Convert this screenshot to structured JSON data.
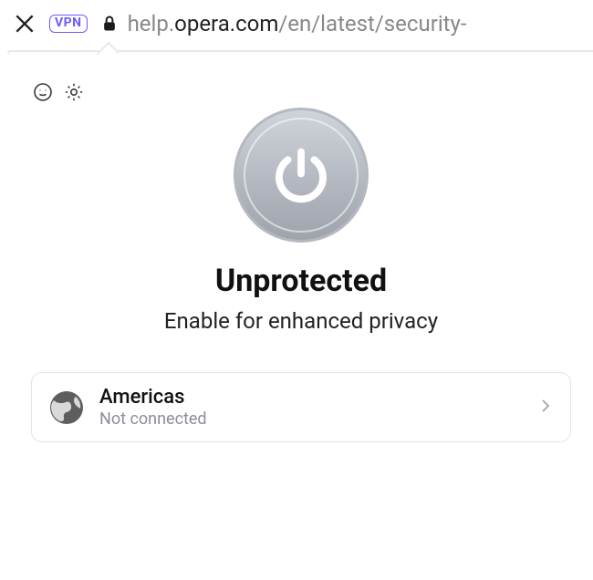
{
  "topbar": {
    "vpn_badge": "VPN",
    "url_prefix": "help.",
    "url_highlight": "opera.com",
    "url_suffix": "/en/latest/security-"
  },
  "panel": {
    "status_title": "Unprotected",
    "status_subtitle": "Enable for enhanced privacy"
  },
  "region": {
    "name": "Americas",
    "status": "Not connected"
  }
}
